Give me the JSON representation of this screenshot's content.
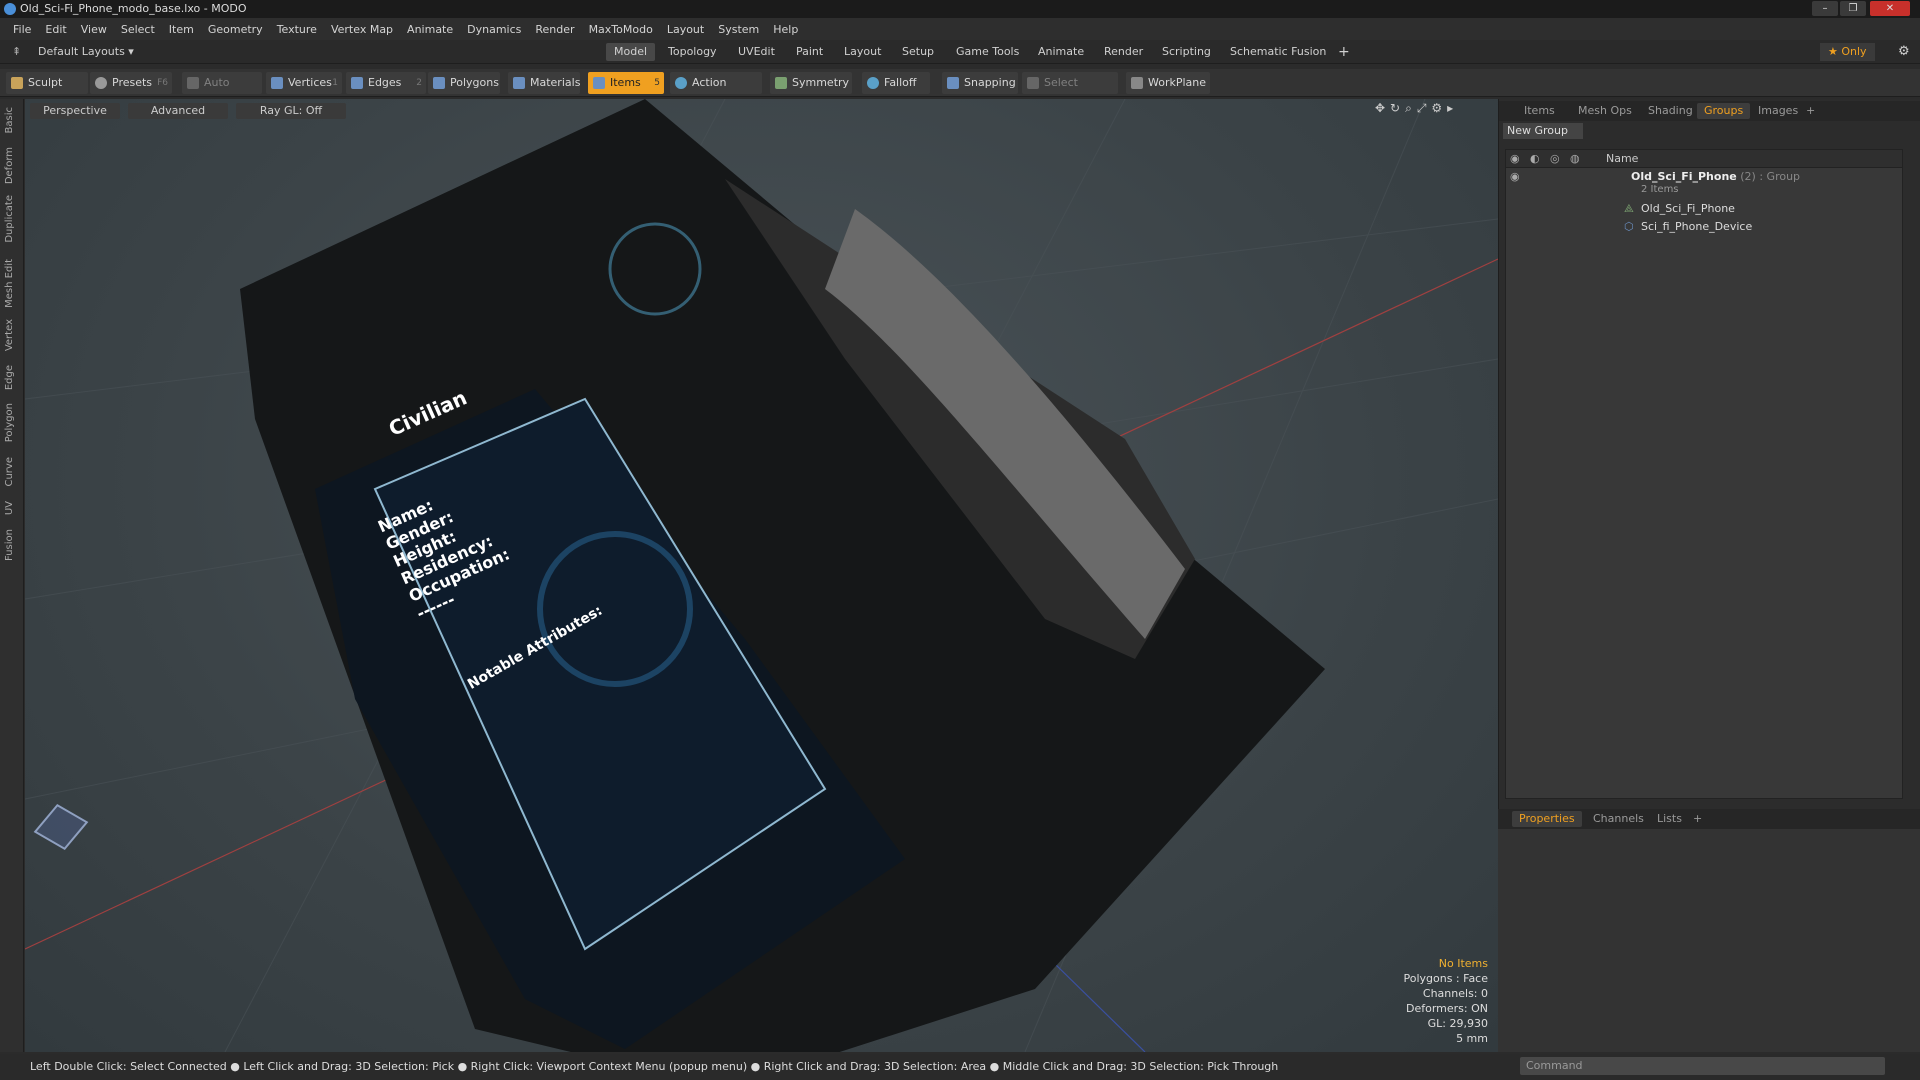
{
  "window": {
    "title": "Old_Sci-Fi_Phone_modo_base.lxo - MODO",
    "controls": [
      "–",
      "❐",
      "✕"
    ]
  },
  "menu": [
    "File",
    "Edit",
    "View",
    "Select",
    "Item",
    "Geometry",
    "Texture",
    "Vertex Map",
    "Animate",
    "Dynamics",
    "Render",
    "MaxToModo",
    "Layout",
    "System",
    "Help"
  ],
  "layout": {
    "preset": "Default Layouts ▾",
    "tabs": [
      "Model",
      "Topology",
      "UVEdit",
      "Paint",
      "Layout",
      "Setup",
      "Game Tools",
      "Animate",
      "Render",
      "Scripting",
      "Schematic Fusion"
    ],
    "active_tab": "Model",
    "add_label": "+",
    "only_label": "★ Only",
    "gear_icon": "gear-icon"
  },
  "toolbar": {
    "sculpt": "Sculpt",
    "presets": "Presets",
    "presets_key": "F6",
    "auto_select": "Auto Select",
    "vertices": "Vertices",
    "vertices_count": "1",
    "edges": "Edges",
    "edges_count": "2",
    "polygons": "Polygons",
    "materials": "Materials",
    "items": "Items",
    "items_count": "5",
    "action_center": "Action Center",
    "symmetry": "Symmetry",
    "falloff": "Falloff",
    "snapping": "Snapping",
    "select_through": "Select Through",
    "workplane": "WorkPlane"
  },
  "left_tabs": [
    "Basic",
    "Deform",
    "Duplicate",
    "Mesh Edit",
    "Vertex",
    "Edge",
    "Polygon",
    "Curve",
    "UV",
    "Fusion"
  ],
  "viewport": {
    "view": "Perspective",
    "shading": "Advanced",
    "raygl": "Ray GL: Off",
    "screen": {
      "title": "Civilian",
      "fields": [
        "Name:",
        "Gender:",
        "Height:",
        "Residency:",
        "Occupation:"
      ],
      "dash": "------",
      "attributes": "Notable Attributes:"
    },
    "stats": {
      "no_items": "No Items",
      "polygons": "Polygons : Face",
      "channels": "Channels: 0",
      "deformers": "Deformers: ON",
      "gl": "GL: 29,930",
      "unit": "5 mm"
    }
  },
  "right_panel": {
    "tabs": [
      "Items",
      "Mesh Ops",
      "Shading",
      "Groups",
      "Images",
      "+"
    ],
    "active_tab": "Groups",
    "new_group": "New Group",
    "column_name": "Name",
    "group": {
      "name": "Old_Sci_Fi_Phone",
      "count": "(2)",
      "type": ": Group",
      "items_label": "2 Items",
      "children": [
        "Old_Sci_Fi_Phone",
        "Sci_fi_Phone_Device"
      ]
    },
    "bottom_tabs": [
      "Properties",
      "Channels",
      "Lists",
      "+"
    ],
    "bottom_active": "Properties",
    "command_placeholder": "Command"
  },
  "status_bar": {
    "text": "Left Double Click: Select Connected ● Left Click and Drag: 3D Selection: Pick ● Right Click: Viewport Context Menu (popup menu) ● Right Click and Drag: 3D Selection: Area ● Middle Click and Drag: 3D Selection: Pick Through"
  },
  "colors": {
    "accent": "#f0a020",
    "close": "#c8302b",
    "screen_blue": "#2a6a9a"
  }
}
